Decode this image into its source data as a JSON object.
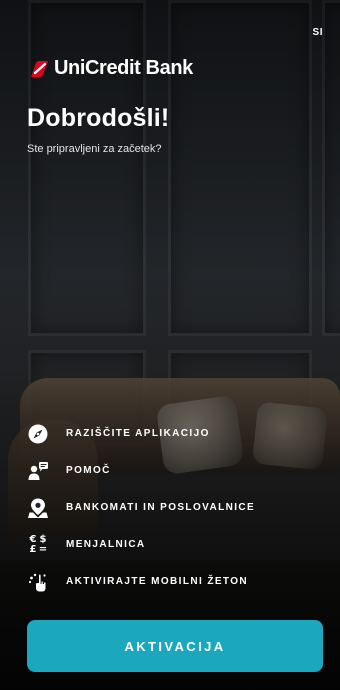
{
  "header": {
    "language": "SI",
    "brand": "UniCredit Bank",
    "brand_color": "#e2001a"
  },
  "welcome": {
    "title": "Dobrodošli!",
    "subtitle": "Ste pripravljeni za začetek?"
  },
  "menu": {
    "items": [
      {
        "icon": "compass-icon",
        "label": "RAZIŠČITE APLIKACIJO"
      },
      {
        "icon": "help-chat-icon",
        "label": "POMOČ"
      },
      {
        "icon": "map-pin-icon",
        "label": "BANKOMATI IN POSLOVALNICE"
      },
      {
        "icon": "currency-exchange-icon",
        "label": "MENJALNICA",
        "glyphs": [
          "€",
          "$",
          "£",
          "="
        ]
      },
      {
        "icon": "mobile-token-icon",
        "label": "AKTIVIRAJTE MOBILNI ŽETON"
      }
    ]
  },
  "cta": {
    "label": "AKTIVACIJA",
    "color": "#1ba7be"
  }
}
